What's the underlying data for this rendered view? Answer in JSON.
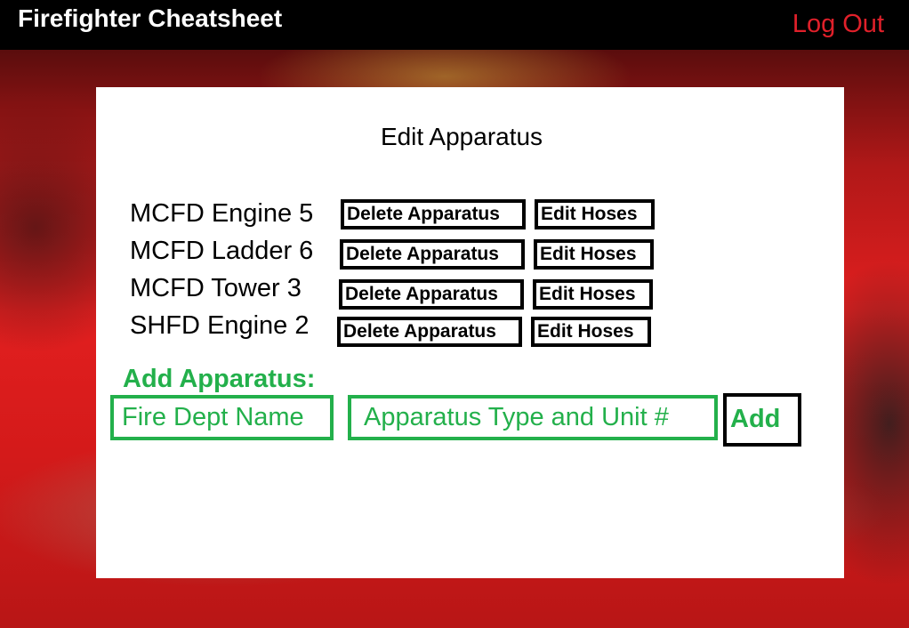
{
  "header": {
    "app_title": "Firefighter Cheatsheet",
    "logout_label": "Log Out"
  },
  "panel": {
    "title": "Edit Apparatus",
    "apparatus": [
      {
        "name": "MCFD Engine 5",
        "delete_label": "Delete Apparatus",
        "edit_label": "Edit Hoses"
      },
      {
        "name": "MCFD Ladder 6",
        "delete_label": "Delete Apparatus",
        "edit_label": "Edit Hoses"
      },
      {
        "name": "MCFD Tower 3",
        "delete_label": "Delete Apparatus",
        "edit_label": "Edit Hoses"
      },
      {
        "name": "SHFD Engine 2",
        "delete_label": "Delete Apparatus",
        "edit_label": "Edit Hoses"
      }
    ],
    "add_section": {
      "heading": "Add Apparatus:",
      "dept_name_placeholder": "Fire Dept Name",
      "apparatus_type_placeholder": "Apparatus Type and Unit #",
      "add_label": "Add"
    }
  },
  "colors": {
    "accent_green": "#23b04b",
    "logout_red": "#e0202a",
    "topbar": "#000000"
  }
}
